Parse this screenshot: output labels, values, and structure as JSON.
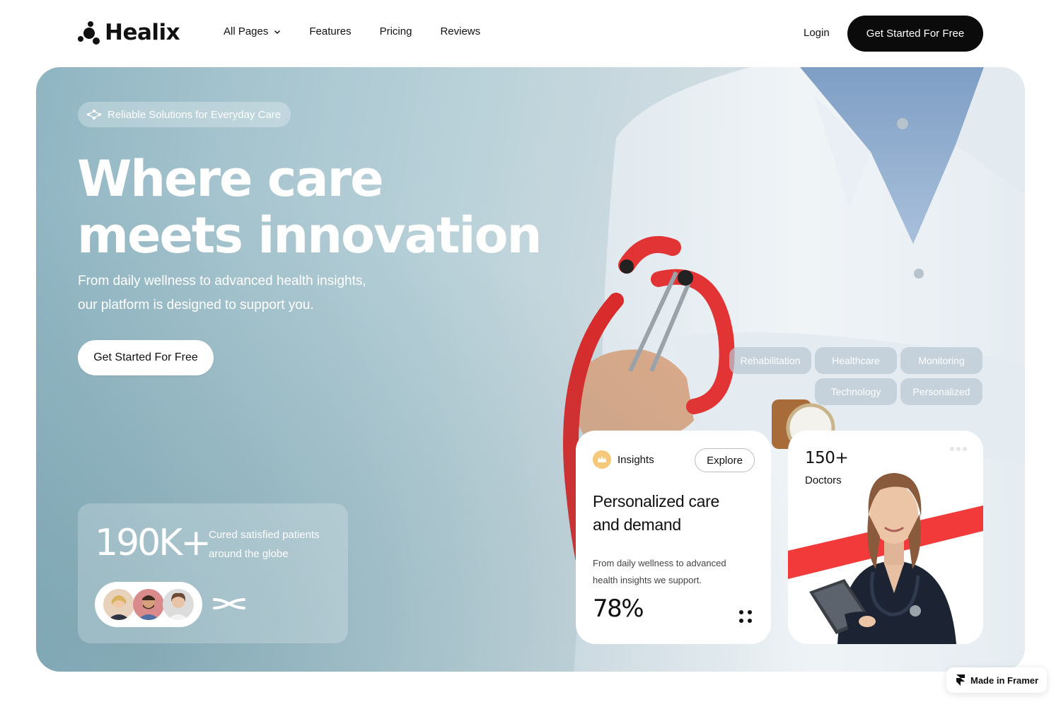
{
  "nav": {
    "brand": "Healix",
    "links": [
      {
        "label": "All Pages",
        "dropdown": true
      },
      {
        "label": "Features"
      },
      {
        "label": "Pricing"
      },
      {
        "label": "Reviews"
      }
    ],
    "login": "Login",
    "cta": "Get Started For Free"
  },
  "hero": {
    "badge": "Reliable Solutions for Everyday Care",
    "headline_line1": "Where care",
    "headline_line2": "meets innovation",
    "subtext_line1": "From daily wellness to advanced health insights,",
    "subtext_line2": "our platform is designed to support you.",
    "cta": "Get Started For Free",
    "stats": {
      "number": "190K+",
      "desc_line1": "Cured satisfied patients",
      "desc_line2": "around the globe"
    },
    "tags": [
      "Rehabilitation",
      "Healthcare",
      "Monitoring",
      "Technology",
      "Personalized"
    ]
  },
  "insights_card": {
    "label": "Insights",
    "button": "Explore",
    "title_line1": "Personalized care",
    "title_line2": "and demand",
    "desc_line1": "From daily wellness to advanced",
    "desc_line2": "health insights we support.",
    "percent": "78%"
  },
  "doctors_card": {
    "number": "150+",
    "label": "Doctors"
  },
  "framer_badge": "Made in Framer",
  "colors": {
    "dark_button": "#0b0b0b",
    "accent_red": "#f23a3a",
    "insight_icon": "#f6c97a",
    "hero_bg_start": "#8fb5c2",
    "hero_bg_end": "#dfe6ea"
  },
  "icons": [
    "logo-mark-icon",
    "chevron-down-icon",
    "sparkle-network-icon",
    "swirl-icon",
    "crown-icon",
    "grid-dots-icon",
    "more-dots-icon",
    "framer-icon"
  ]
}
